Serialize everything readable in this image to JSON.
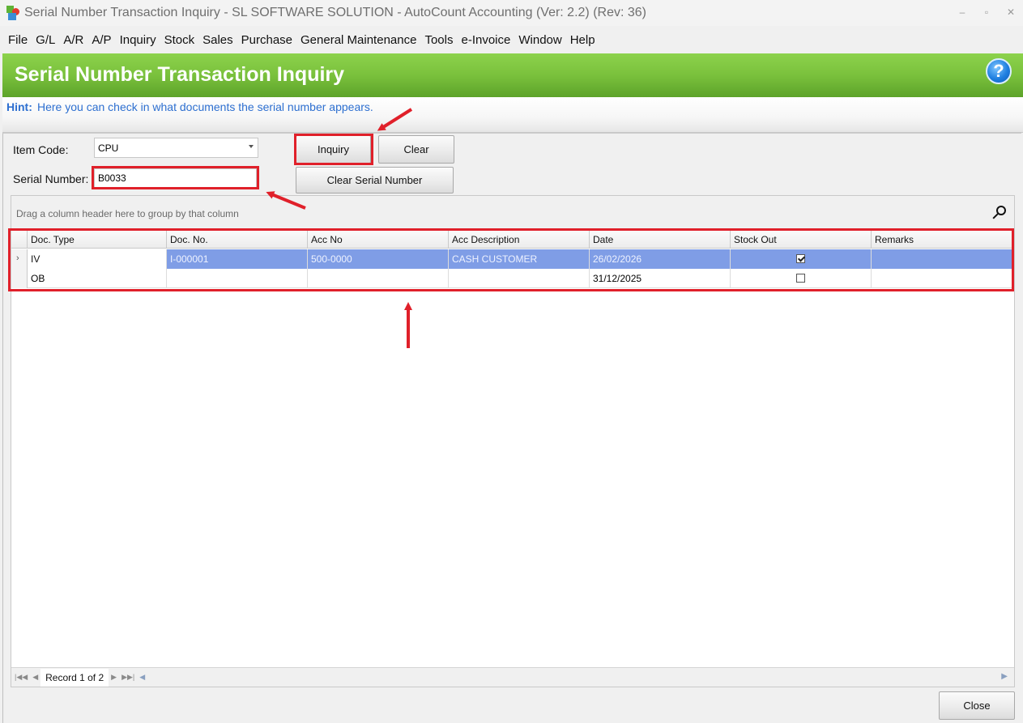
{
  "window": {
    "title": "Serial Number Transaction Inquiry - SL SOFTWARE SOLUTION - AutoCount Accounting (Ver: 2.2) (Rev: 36)",
    "minimize_glyph": "–",
    "maximize_glyph": "▫",
    "close_glyph": "✕"
  },
  "menu": [
    "File",
    "G/L",
    "A/R",
    "A/P",
    "Inquiry",
    "Stock",
    "Sales",
    "Purchase",
    "General Maintenance",
    "Tools",
    "e-Invoice",
    "Window",
    "Help"
  ],
  "header": {
    "title": "Serial Number Transaction Inquiry",
    "help_glyph": "?"
  },
  "hint": {
    "label": "Hint:",
    "text": "Here you can check in what documents the serial number appears."
  },
  "form": {
    "item_code_label": "Item Code:",
    "item_code_value": "CPU",
    "serial_label": "Serial Number:",
    "serial_value": "B0033"
  },
  "buttons": {
    "inquiry": "Inquiry",
    "clear": "Clear",
    "clear_serial": "Clear Serial Number",
    "close": "Close"
  },
  "grid": {
    "group_hint": "Drag a column header here to group by that column",
    "columns": [
      "Doc. Type",
      "Doc. No.",
      "Acc No",
      "Acc Description",
      "Date",
      "Stock Out",
      "Remarks"
    ],
    "rows": [
      {
        "doc_type": "IV",
        "doc_no": "I-000001",
        "acc_no": "500-0000",
        "acc_desc": "CASH CUSTOMER",
        "date": "26/02/2026",
        "stock_out": true,
        "remarks": ""
      },
      {
        "doc_type": "OB",
        "doc_no": "",
        "acc_no": "",
        "acc_desc": "",
        "date": "31/12/2025",
        "stock_out": false,
        "remarks": ""
      }
    ],
    "record_text": "Record 1 of 2"
  },
  "colors": {
    "accent_green": "#7ac13c",
    "highlight_red": "#e0202a",
    "selection_blue": "#7f9de6",
    "hint_blue": "#2d6fd0"
  }
}
